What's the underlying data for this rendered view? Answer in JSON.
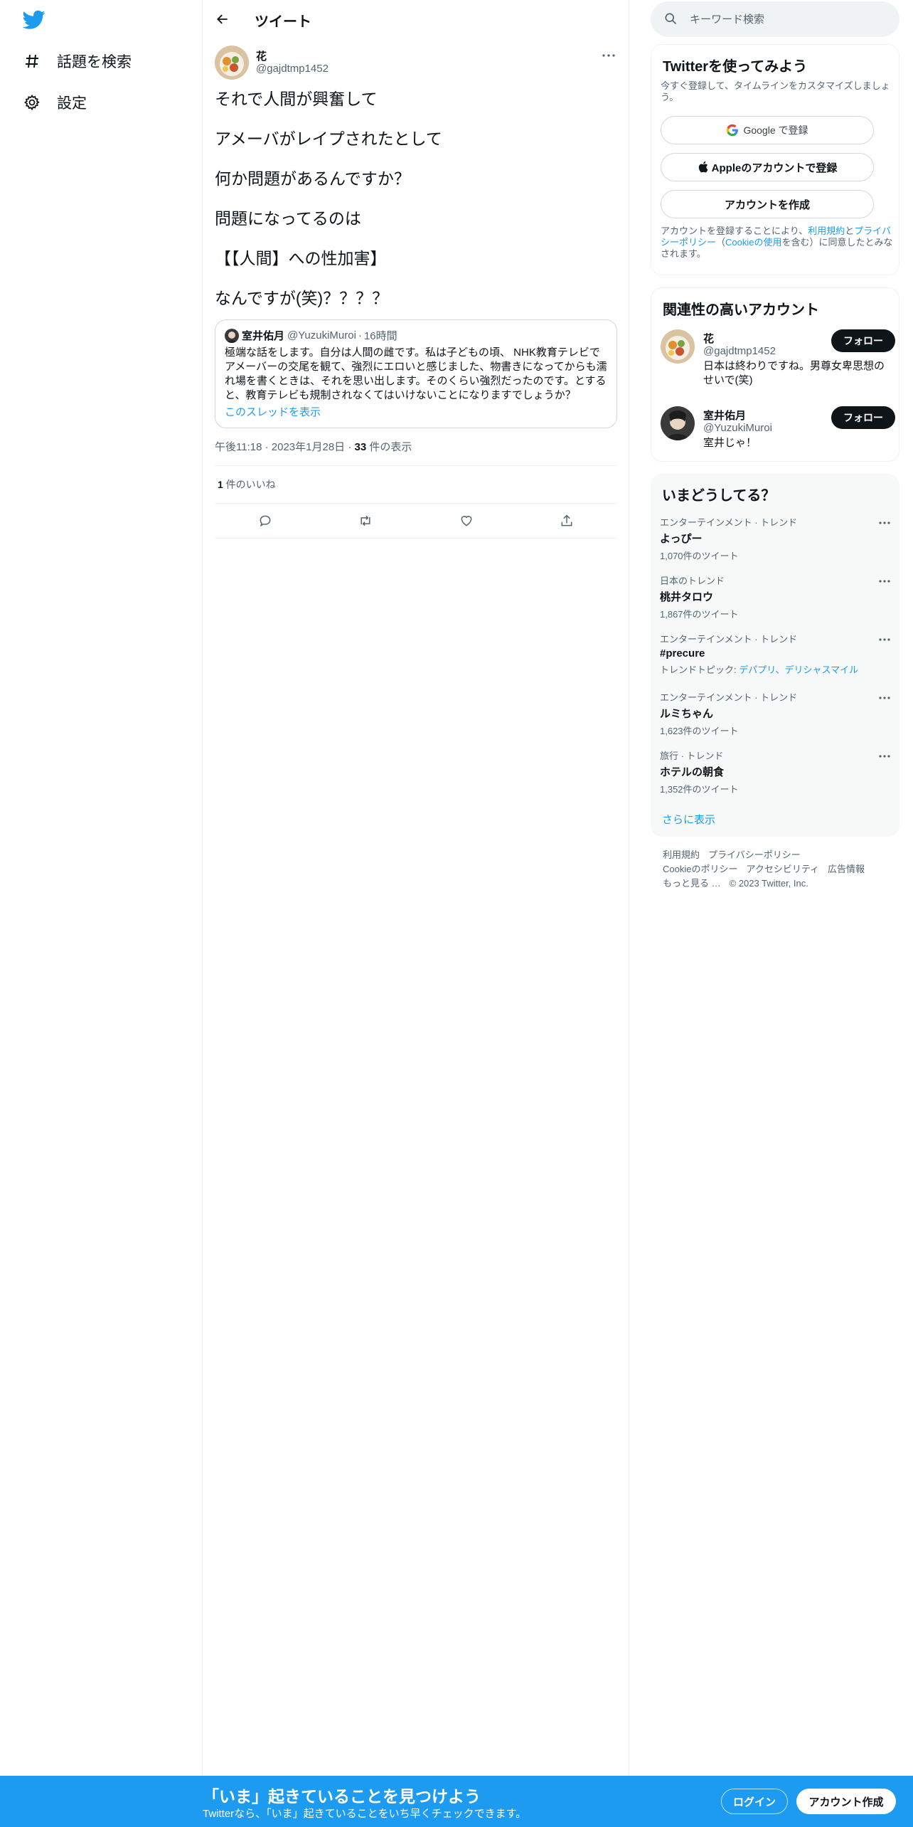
{
  "nav": {
    "items": [
      {
        "label": "話題を検索",
        "icon": "hashtag-icon"
      },
      {
        "label": "設定",
        "icon": "gear-icon"
      }
    ]
  },
  "header": {
    "title": "ツイート"
  },
  "tweet": {
    "author_name": "花",
    "author_handle": "@gajdtmp1452",
    "lines": [
      "それで人間が興奮して",
      "アメーバがレイプされたとして",
      "何か問題があるんですか？",
      "問題になってるのは",
      "【【人間】への性加害】",
      "なんですが(笑)？？？？"
    ],
    "quote": {
      "name": "室井佑月",
      "handle": "@YuzukiMuroi",
      "separator": "·",
      "time": "16時間",
      "text": "極端な話をします。自分は人間の雌です。私は子どもの頃、 NHK教育テレビでアメーバーの交尾を観て、強烈にエロいと感じました、物書きになってからも濡れ場を書くときは、それを思い出します。そのくらい強烈だったのです。とすると、教育テレビも規制されなくてはいけないことになりますでしょうか？",
      "thread_link": "このスレッドを表示"
    },
    "time": "午後11:18",
    "dot1": "·",
    "date": "2023年1月28日",
    "dot2": "·",
    "views_count": "33",
    "views_label": " 件の表示",
    "likes_count": "1",
    "likes_label": " 件のいいね"
  },
  "search": {
    "placeholder": "キーワード検索"
  },
  "signup": {
    "title": "Twitterを使ってみよう",
    "subtitle": "今すぐ登録して、タイムラインをカスタマイズしましょう。",
    "google_label": "Google で登録",
    "apple_label": "Appleのアカウントで登録",
    "create_label": "アカウントを作成",
    "legal_prefix": "アカウントを登録することにより、",
    "legal_terms": "利用規約",
    "legal_and": "と",
    "legal_privacy": "プライバシーポリシー",
    "legal_paren_open": "（",
    "legal_cookie": "Cookieの使用",
    "legal_suffix": "を含む）に同意したとみなされます。"
  },
  "related": {
    "title": "関連性の高いアカウント",
    "accounts": [
      {
        "name": "花",
        "handle": "@gajdtmp1452",
        "bio": "日本は終わりですね。男尊女卑思想のせいで(笑)",
        "follow_label": "フォロー"
      },
      {
        "name": "室井佑月",
        "handle": "@YuzukiMuroi",
        "bio": "室井じゃ！",
        "follow_label": "フォロー"
      }
    ]
  },
  "trends": {
    "title": "いまどうしてる？",
    "items": [
      {
        "category": "エンターテインメント · トレンド",
        "title": "よっぴー",
        "count": "1,070件のツイート"
      },
      {
        "category": "日本のトレンド",
        "title": "桃井タロウ",
        "count": "1,867件のツイート"
      },
      {
        "category": "エンターテインメント · トレンド",
        "title": "#precure",
        "count_prefix": "トレンドトピック: ",
        "count_links": "デパプリ、デリシャスマイル"
      },
      {
        "category": "エンターテインメント · トレンド",
        "title": "ルミちゃん",
        "count": "1,623件のツイート"
      },
      {
        "category": "旅行 · トレンド",
        "title": "ホテルの朝食",
        "count": "1,352件のツイート"
      }
    ],
    "show_more": "さらに表示"
  },
  "footer": {
    "links": [
      "利用規約",
      "プライバシーポリシー",
      "Cookieのポリシー",
      "アクセシビリティ",
      "広告情報",
      "もっと見る …",
      "© 2023 Twitter, Inc."
    ]
  },
  "banner": {
    "title": "「いま」起きていることを見つけよう",
    "subtitle": "Twitterなら、「いま」起きていることをいち早くチェックできます。",
    "login_label": "ログイン",
    "create_label": "アカウント作成"
  },
  "colors": {
    "accent": "#1d9bf0",
    "text": "#0f1419",
    "secondary": "#536471",
    "border": "#eff3f4"
  }
}
